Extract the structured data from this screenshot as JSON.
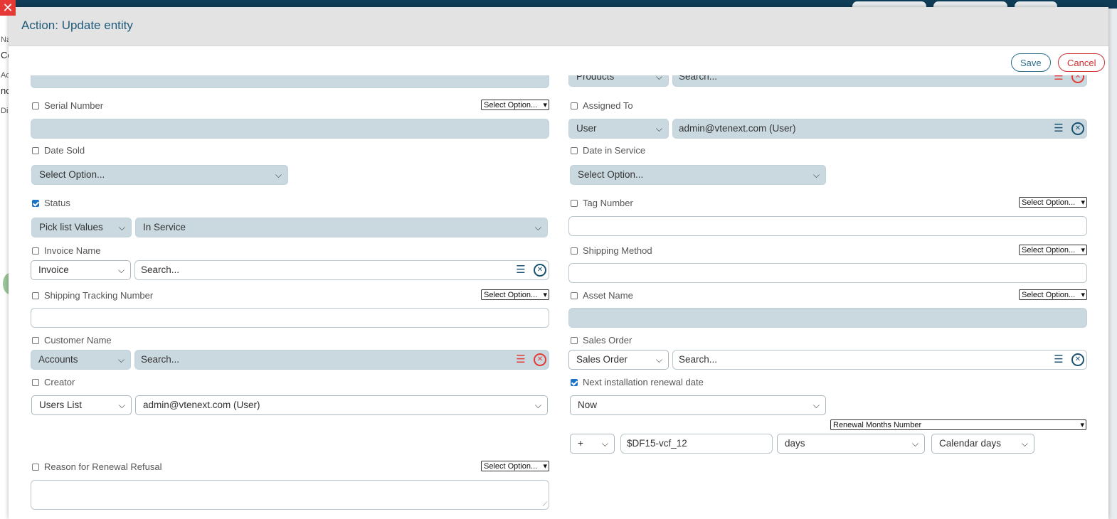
{
  "modal": {
    "title": "Action: Update entity",
    "save_label": "Save",
    "cancel_label": "Cancel"
  },
  "background": {
    "left_letters": [
      "Na",
      "Co",
      "Ac",
      "nc",
      "Di"
    ]
  },
  "top_cutoff": {
    "left_value": "",
    "right_select": "Products",
    "right_search": "Search..."
  },
  "fields": {
    "serial_number": {
      "label": "Serial Number",
      "option": "Select Option...",
      "checked": false
    },
    "assigned_to": {
      "label": "Assigned To",
      "type_select": "User",
      "value": "admin@vtenext.com (User)",
      "checked": false
    },
    "date_sold": {
      "label": "Date Sold",
      "select": "Select Option...",
      "checked": false
    },
    "date_in_service": {
      "label": "Date in Service",
      "select": "Select Option...",
      "checked": false
    },
    "status": {
      "label": "Status",
      "type_select": "Pick list Values",
      "value_select": "In Service",
      "checked": true
    },
    "tag_number": {
      "label": "Tag Number",
      "option": "Select Option...",
      "checked": false
    },
    "invoice_name": {
      "label": "Invoice Name",
      "type_select": "Invoice",
      "search": "Search...",
      "checked": false
    },
    "shipping_method": {
      "label": "Shipping Method",
      "option": "Select Option...",
      "checked": false
    },
    "shipping_tracking_number": {
      "label": "Shipping Tracking Number",
      "option": "Select Option...",
      "checked": false
    },
    "asset_name": {
      "label": "Asset Name",
      "option": "Select Option...",
      "checked": false
    },
    "customer_name": {
      "label": "Customer Name",
      "type_select": "Accounts",
      "search": "Search...",
      "checked": false
    },
    "sales_order": {
      "label": "Sales Order",
      "type_select": "Sales Order",
      "search": "Search...",
      "checked": false
    },
    "creator": {
      "label": "Creator",
      "type_select": "Users List",
      "value_select": "admin@vtenext.com (User)",
      "checked": false
    },
    "next_renewal": {
      "label": "Next installation renewal date",
      "checked": true,
      "base_select": "Now",
      "months_select": "Renewal Months Number",
      "operator": "+",
      "expression": "$DF15-vcf_12",
      "unit": "days",
      "calendar": "Calendar days"
    },
    "reason_refusal": {
      "label": "Reason for Renewal Refusal",
      "option": "Select Option...",
      "checked": false
    }
  },
  "colors": {
    "header_text": "#1f5a7a",
    "field_fill": "#cad9e0",
    "accent_blue": "#1b5272",
    "danger_red": "#e53935"
  }
}
